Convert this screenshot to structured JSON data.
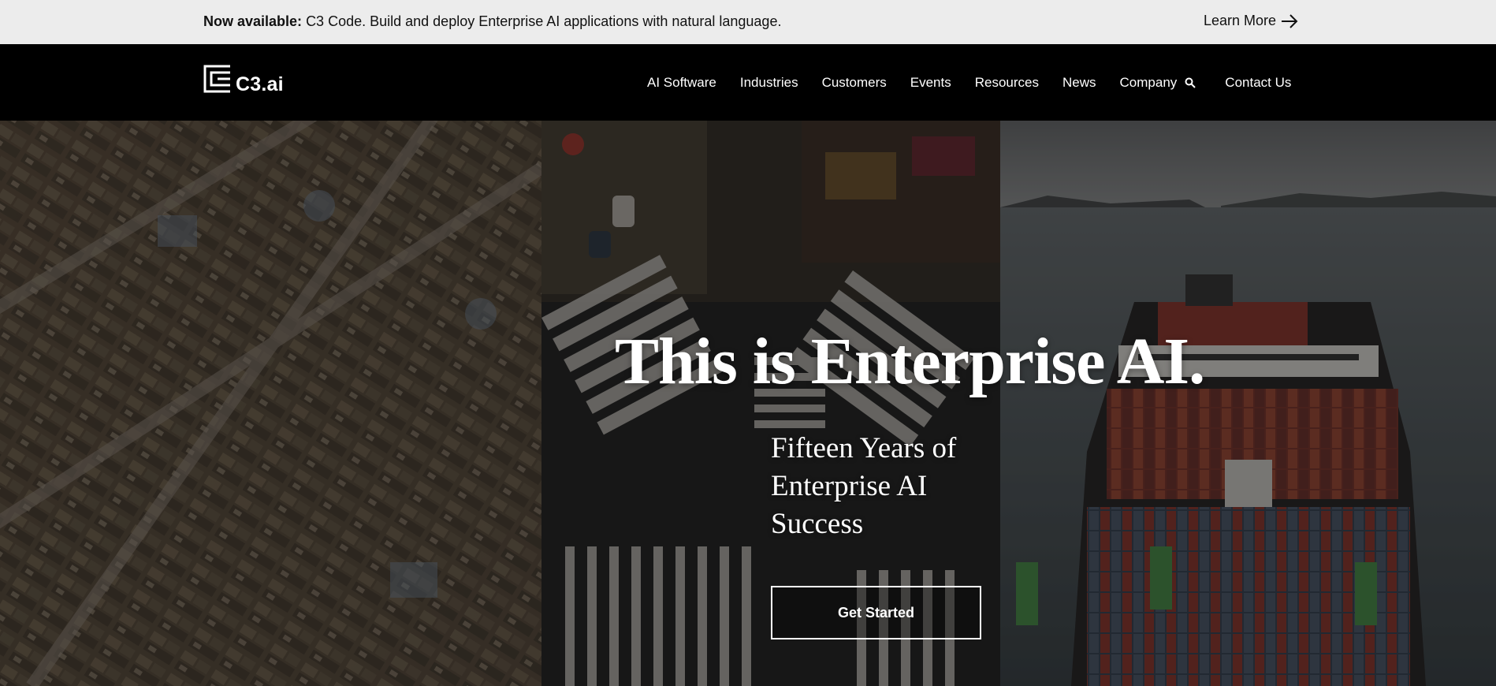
{
  "announcement": {
    "label": "Now available:",
    "message": "C3 Code. Build and deploy Enterprise AI applications with natural language.",
    "link": "Learn More",
    "link_icon": "arrow-right-icon"
  },
  "nav": {
    "logo_text": "C3.ai",
    "logo_icon": "c3-logo-icon",
    "items": [
      {
        "label": "AI Software"
      },
      {
        "label": "Industries"
      },
      {
        "label": "Customers"
      },
      {
        "label": "Events"
      },
      {
        "label": "Resources"
      },
      {
        "label": "News"
      },
      {
        "label": "Company"
      }
    ],
    "search_icon": "search-icon",
    "contact": "Contact Us"
  },
  "hero": {
    "headline": "This is Enterprise AI.",
    "subhead": "Fifteen Years of Enterprise AI Success",
    "cta": "Get Started"
  },
  "colors": {
    "announcement_bg": "#ececec",
    "nav_bg": "#000000",
    "text_light": "#ffffff"
  }
}
